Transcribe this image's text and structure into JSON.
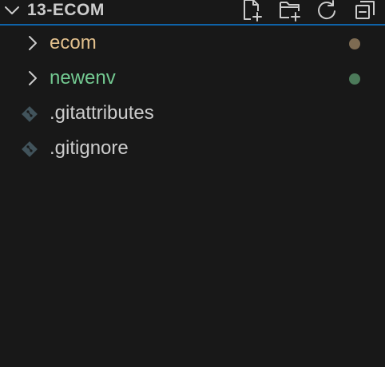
{
  "explorer": {
    "title": "13-ECOM",
    "accent": "#0e62a8",
    "actions": [
      {
        "icon": "new-file-icon"
      },
      {
        "icon": "new-folder-icon"
      },
      {
        "icon": "refresh-icon"
      },
      {
        "icon": "collapse-all-icon"
      }
    ]
  },
  "tree": {
    "items": [
      {
        "label": "ecom",
        "kind": "folder",
        "color": "#e2c08d",
        "dot_color": "#7d6b52"
      },
      {
        "label": "newenv",
        "kind": "folder",
        "color": "#73c991",
        "dot_color": "#4c7a5a"
      },
      {
        "label": ".gitattributes",
        "kind": "file",
        "color": "#cccccc",
        "icon": "git-icon"
      },
      {
        "label": ".gitignore",
        "kind": "file",
        "color": "#cccccc",
        "icon": "git-icon"
      }
    ]
  }
}
